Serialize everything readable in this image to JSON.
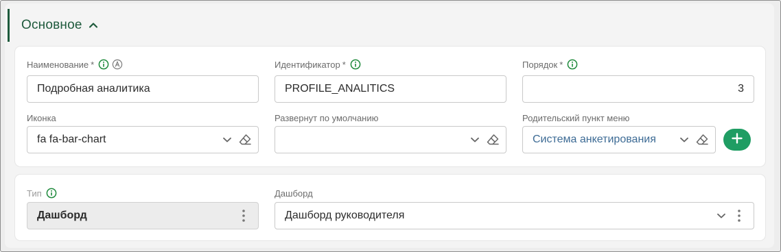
{
  "section": {
    "title": "Основное"
  },
  "fields": {
    "name": {
      "label": "Наименование",
      "required": "*",
      "value": "Подробная аналитика"
    },
    "identifier": {
      "label": "Идентификатор",
      "required": "*",
      "value": "PROFILE_ANALITICS"
    },
    "order": {
      "label": "Порядок",
      "required": "*",
      "value": "3"
    },
    "icon": {
      "label": "Иконка",
      "value": "fa fa-bar-chart"
    },
    "expanded": {
      "label": "Развернут по умолчанию",
      "value": ""
    },
    "parent": {
      "label": "Родительский пункт меню",
      "value": "Система анкетирования"
    },
    "type": {
      "label": "Тип",
      "value": "Дашборд"
    },
    "dashboard": {
      "label": "Дашборд",
      "value": "Дашборд руководителя"
    }
  },
  "colors": {
    "accent": "#1e5a3c",
    "info": "#1f8a3c",
    "add_button": "#1f9d63",
    "link": "#3d6b95"
  },
  "icons": [
    "chevron-up-icon",
    "info-icon",
    "auto-icon",
    "chevron-down-icon",
    "eraser-icon",
    "plus-icon",
    "kebab-icon"
  ]
}
